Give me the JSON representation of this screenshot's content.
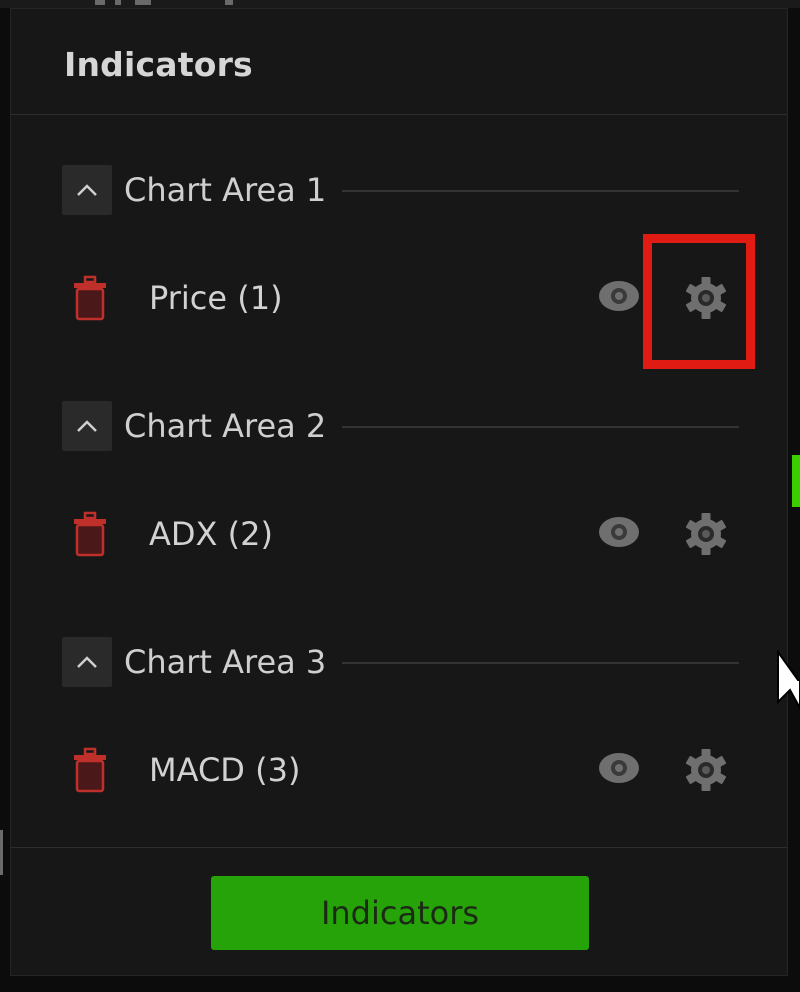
{
  "panel": {
    "title": "Indicators"
  },
  "sections": [
    {
      "label": "Chart Area 1",
      "indicator": {
        "label": "Price (1)",
        "visible": true
      }
    },
    {
      "label": "Chart Area 2",
      "indicator": {
        "label": "ADX (2)",
        "visible": true
      }
    },
    {
      "label": "Chart Area 3",
      "indicator": {
        "label": "MACD (3)",
        "visible": true
      }
    }
  ],
  "footer": {
    "button_label": "Indicators"
  },
  "icons": {
    "collapse": "chevron-up-icon",
    "delete": "trash-icon",
    "visibility": "eye-icon",
    "settings": "gear-icon"
  },
  "colors": {
    "panel_bg": "#171717",
    "trash": "#c0302b",
    "button_green": "#27a30a",
    "highlight": "#e01b14",
    "icon_gray": "#6f6f6f"
  }
}
